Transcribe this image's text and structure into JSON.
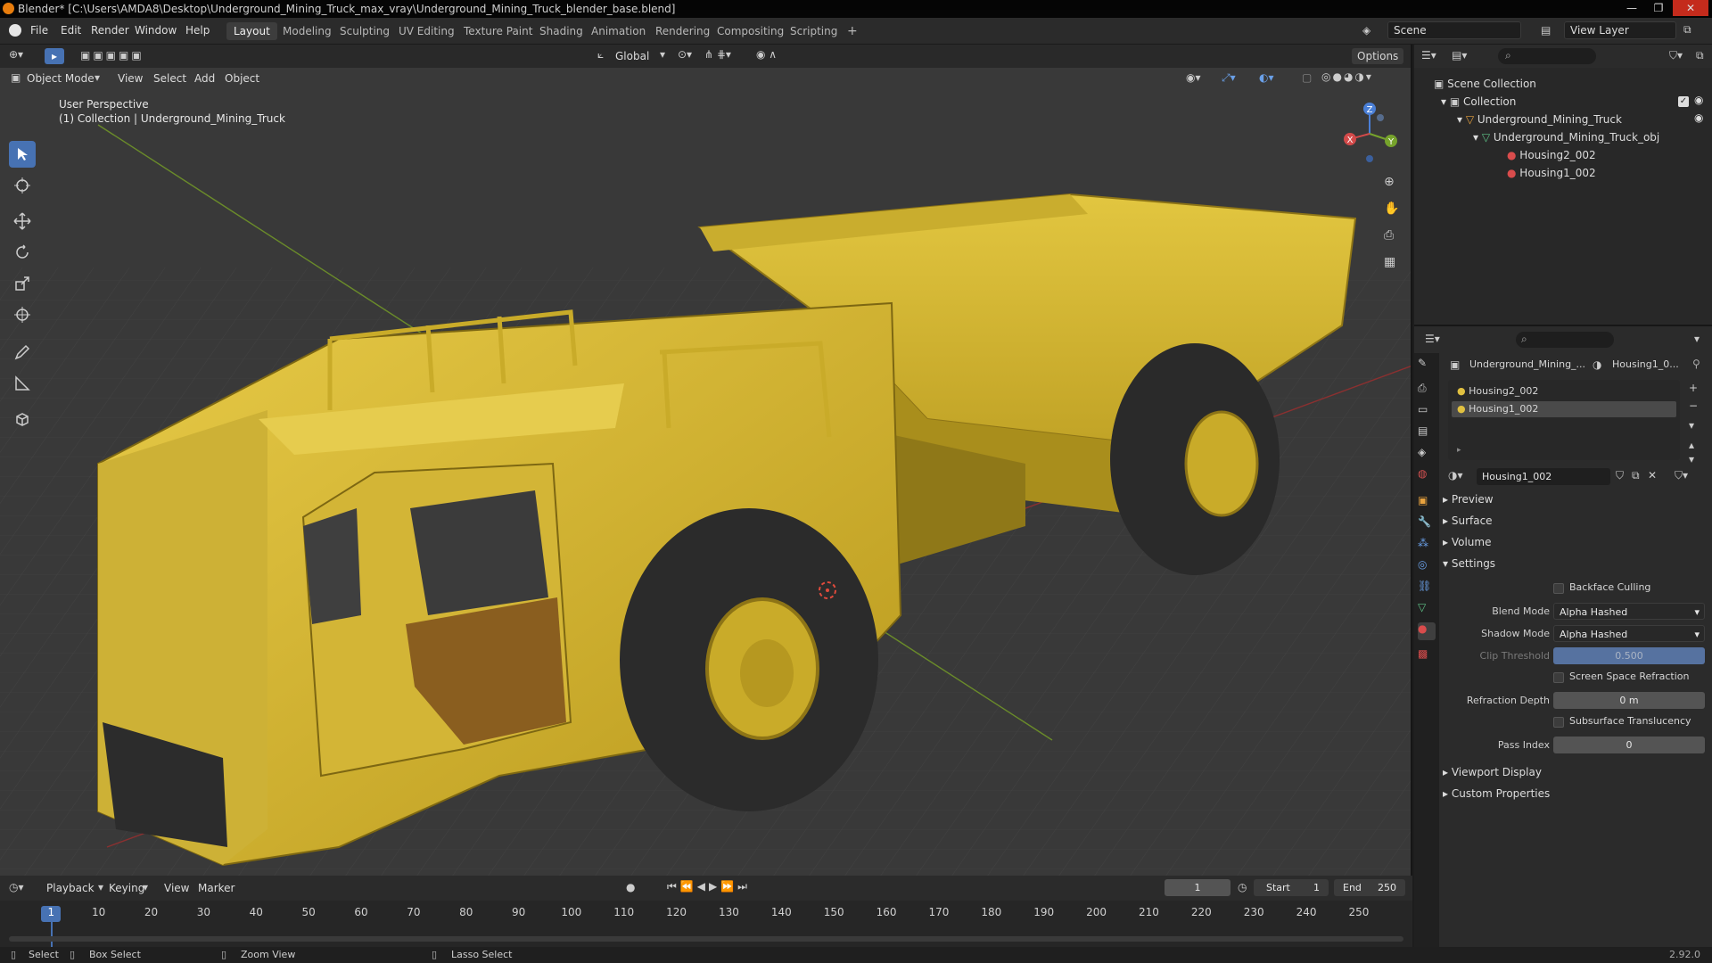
{
  "window": {
    "title": "Blender* [C:\\Users\\AMDA8\\Desktop\\Underground_Mining_Truck_max_vray\\Underground_Mining_Truck_blender_base.blend]"
  },
  "menu": {
    "file": "File",
    "edit": "Edit",
    "render": "Render",
    "window": "Window",
    "help": "Help"
  },
  "workspaces": [
    "Layout",
    "Modeling",
    "Sculpting",
    "UV Editing",
    "Texture Paint",
    "Shading",
    "Animation",
    "Rendering",
    "Compositing",
    "Scripting"
  ],
  "active_workspace": "Layout",
  "scene": {
    "name": "Scene",
    "view_layer": "View Layer"
  },
  "viewport": {
    "orientation": "Global",
    "options": "Options",
    "mode": "Object Mode",
    "menus": {
      "view": "View",
      "select": "Select",
      "add": "Add",
      "object": "Object"
    },
    "overlay_line1": "User Perspective",
    "overlay_line2": "(1) Collection | Underground_Mining_Truck",
    "gizmo": {
      "x": "X",
      "y": "Y",
      "z": "Z"
    }
  },
  "outliner": {
    "scene_collection": "Scene Collection",
    "collection": "Collection",
    "object": "Underground_Mining_Truck",
    "mesh": "Underground_Mining_Truck_obj",
    "mat1": "Housing2_002",
    "mat2": "Housing1_002"
  },
  "properties": {
    "breadcrumb_object": "Underground_Mining_...",
    "breadcrumb_material": "Housing1_0...",
    "slots": [
      "Housing2_002",
      "Housing1_002"
    ],
    "active_slot": "Housing1_002",
    "material_name": "Housing1_002",
    "sections": {
      "preview": "Preview",
      "surface": "Surface",
      "volume": "Volume",
      "settings": "Settings",
      "viewport_display": "Viewport Display",
      "custom_properties": "Custom Properties"
    },
    "settings": {
      "backface_culling": "Backface Culling",
      "blend_mode_label": "Blend Mode",
      "blend_mode": "Alpha Hashed",
      "shadow_mode_label": "Shadow Mode",
      "shadow_mode": "Alpha Hashed",
      "clip_threshold_label": "Clip Threshold",
      "clip_threshold": "0.500",
      "ssr": "Screen Space Refraction",
      "refraction_depth_label": "Refraction Depth",
      "refraction_depth": "0 m",
      "sss": "Subsurface Translucency",
      "pass_index_label": "Pass Index",
      "pass_index": "0"
    }
  },
  "timeline": {
    "menus": {
      "playback": "Playback",
      "keying": "Keying",
      "view": "View",
      "marker": "Marker"
    },
    "current_frame": "1",
    "start_label": "Start",
    "start": "1",
    "end_label": "End",
    "end": "250",
    "ticks": [
      "1",
      "10",
      "20",
      "30",
      "40",
      "50",
      "60",
      "70",
      "80",
      "90",
      "100",
      "110",
      "120",
      "130",
      "140",
      "150",
      "160",
      "170",
      "180",
      "190",
      "200",
      "210",
      "220",
      "230",
      "240",
      "250"
    ]
  },
  "statusbar": {
    "select": "Select",
    "box_select": "Box Select",
    "zoom_view": "Zoom View",
    "lasso_select": "Lasso Select",
    "version": "2.92.0"
  },
  "colors": {
    "accent": "#4772b3",
    "truck": "#d8bc3a",
    "tire": "#2b2b2b",
    "bg": "#3a3a3a"
  }
}
